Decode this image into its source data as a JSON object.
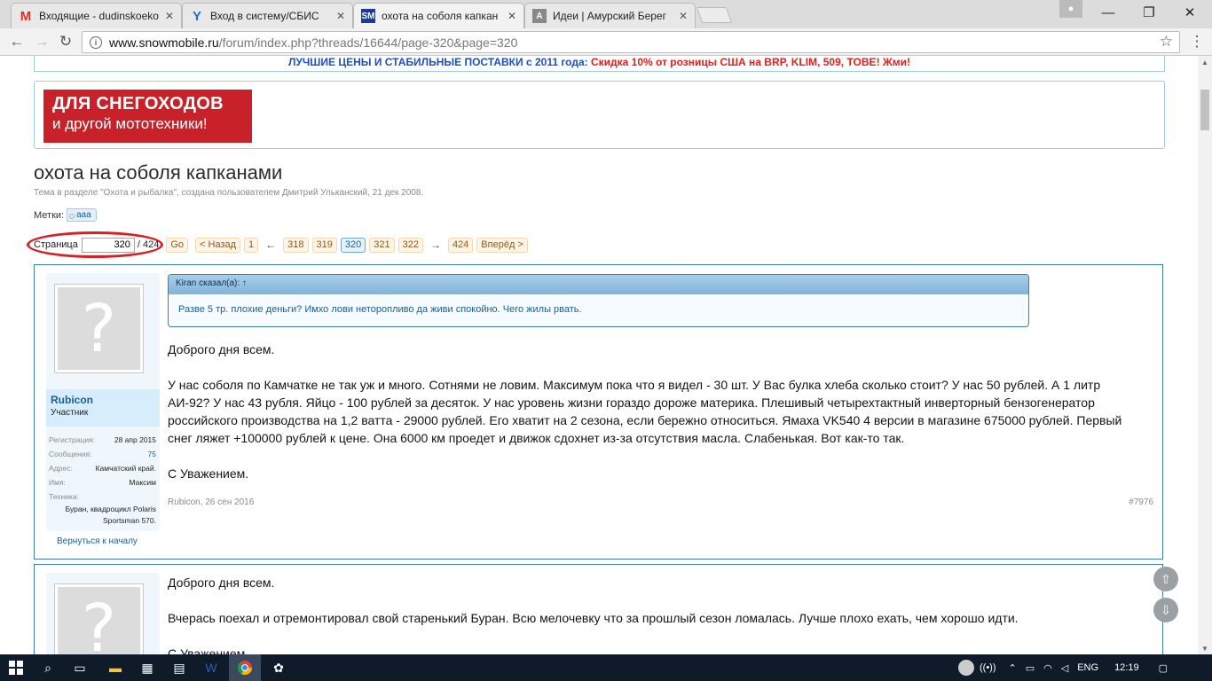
{
  "browser": {
    "tabs": [
      {
        "title": "Входящие - dudinskoeko",
        "icon": "gmail-icon",
        "active": false
      },
      {
        "title": "Вход в систему/СБИС",
        "icon": "sbis-icon",
        "active": false
      },
      {
        "title": "охота на соболя капкан",
        "icon": "snowmobile-favicon",
        "active": true
      },
      {
        "title": "Идеи | Амурский Берег",
        "icon": "page-favicon",
        "active": false
      }
    ],
    "url_domain": "www.snowmobile.ru",
    "url_path": "/forum/index.php?threads/16644/page-320&page=320"
  },
  "page": {
    "promo_blue": "ЛУЧШИЕ ЦЕНЫ И СТАБИЛЬНЫЕ ПОСТАВКИ с 2011 года:",
    "promo_red": "Скидка 10% от розницы США на BRP, KLIM, 509, TOBE! Жми!",
    "banner_line1": "ДЛЯ СНЕГОХОДОВ",
    "banner_line2": "и другой мототехники!",
    "title": "охота на соболя капканами",
    "subtitle": "Тема в разделе \"Охота и рыбалка\", создана пользователем Дмитрий Ульканский, 21 дек 2008.",
    "tags_label": "Метки:",
    "tag": "aaa",
    "pagenav": {
      "label": "Страница",
      "current": "320",
      "total": "/ 424",
      "go": "Go",
      "prev": "< Назад",
      "first": "1",
      "arrow_left": "←",
      "pages": [
        "318",
        "319",
        "320",
        "321",
        "322"
      ],
      "arrow_right": "→",
      "last": "424",
      "next": "Вперёд >"
    }
  },
  "post1": {
    "user": "Rubicon",
    "role": "Участник",
    "info": [
      {
        "k": "Регистрация:",
        "v": "28 апр 2015"
      },
      {
        "k": "Сообщения:",
        "v": "75"
      },
      {
        "k": "Адрес:",
        "v": "Камчатский край."
      },
      {
        "k": "Имя:",
        "v": "Максим"
      }
    ],
    "tech_label": "Техника:",
    "tech_value": "Буран, квадроцикл Polaris Sportsman 570.",
    "back_to_top": "Вернуться к началу",
    "quote_header": "Kiran сказал(а): ↑",
    "quote_body": "Разве 5 тр. плохие деньги? Имхо лови неторопливо да живи спокойно. Чего жилы рвать.",
    "greeting": "Доброго дня всем.",
    "body": "У нас соболя по Камчатке не так уж и много. Сотнями не ловим. Максимум пока что я видел - 30 шт. У Вас булка хлеба сколько стоит? У нас 50 рублей. А 1 литр АИ-92? У нас 43 рубля. Яйцо - 100 рублей за десяток. У нас уровень жизни гораздо дороже материка. Плешивый четырехтактный инверторный бензогенератор российского производства на 1,2 ватта - 29000 рублей. Его хватит на 2 сезона, если бережно относиться. Ямаха VK540 4 версии в магазине 675000 рублей. Первый снег ляжет +100000 рублей к цене. Она 6000 км проедет и движок сдохнет из-за отсутствия масла. Слабенькая. Вот как-то так.",
    "signoff": "С Уважением.",
    "meta": "Rubicon, 26 сен 2016",
    "number": "#7976"
  },
  "post2": {
    "greeting": "Доброго дня всем.",
    "body": "Вчерась поехал и отремонтировал свой старенький Буран. Всю мелочевку что за прошлый сезон ломалась. Лучше плохо ехать, чем хорошо идти.",
    "signoff": "С Уважением."
  },
  "taskbar": {
    "lang": "ENG",
    "time": "12:19"
  }
}
